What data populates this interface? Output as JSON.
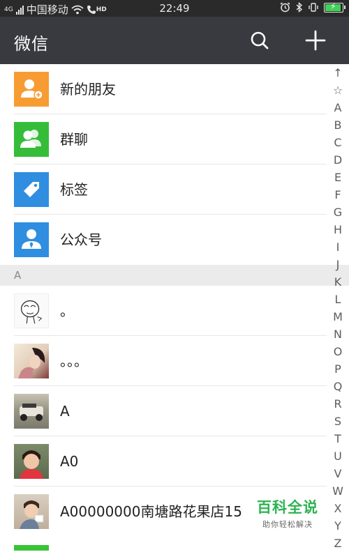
{
  "status_bar": {
    "carrier": "中国移动",
    "time": "22:49",
    "network_label": "4G",
    "hd_label": "HD"
  },
  "header": {
    "title": "微信",
    "search_icon": "search-icon",
    "add_icon": "plus-icon"
  },
  "top_items": [
    {
      "label": "新的朋友",
      "color": "#f79c32",
      "icon": "add-friend-icon"
    },
    {
      "label": "群聊",
      "color": "#35bd3a",
      "icon": "group-chat-icon"
    },
    {
      "label": "标签",
      "color": "#2f8ee0",
      "icon": "tag-icon"
    },
    {
      "label": "公众号",
      "color": "#2f8ee0",
      "icon": "official-account-icon"
    }
  ],
  "sections": [
    {
      "letter": "A",
      "contacts": [
        {
          "name": "。"
        },
        {
          "name": "。。。"
        },
        {
          "name": "A"
        },
        {
          "name": "A0"
        },
        {
          "name": "A00000000南塘路花果店15"
        }
      ]
    }
  ],
  "index_bar": [
    "↑",
    "☆",
    "A",
    "B",
    "C",
    "D",
    "E",
    "F",
    "G",
    "H",
    "I",
    "J",
    "K",
    "L",
    "M",
    "N",
    "O",
    "P",
    "Q",
    "R",
    "S",
    "T",
    "U",
    "V",
    "W",
    "X",
    "Y",
    "Z"
  ],
  "watermark": {
    "title": "百科全说",
    "subtitle": "助你轻松解决"
  },
  "colors": {
    "titlebar": "#393a3f",
    "watermark": "#2db350"
  }
}
